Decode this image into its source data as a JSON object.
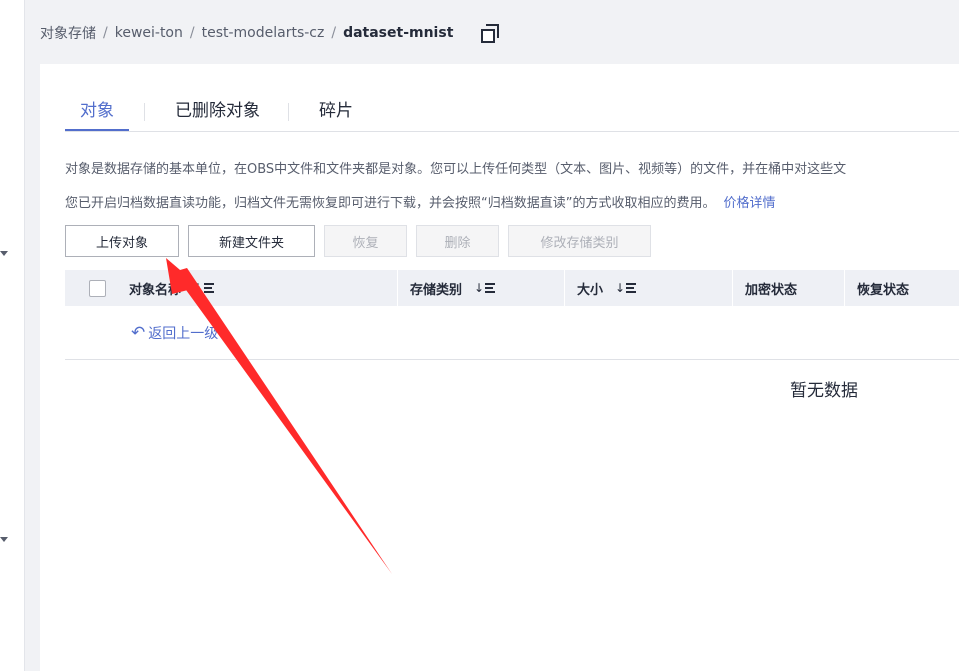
{
  "breadcrumb": {
    "items": [
      "对象存储",
      "kewei-ton",
      "test-modelarts-cz"
    ],
    "current": "dataset-mnist",
    "separator": "/",
    "copy_icon": "copy-icon"
  },
  "tabs": [
    {
      "label": "对象",
      "active": true
    },
    {
      "label": "已删除对象",
      "active": false
    },
    {
      "label": "碎片",
      "active": false
    }
  ],
  "description": {
    "line1": "对象是数据存储的基本单位，在OBS中文件和文件夹都是对象。您可以上传任何类型（文本、图片、视频等）的文件，并在桶中对这些文",
    "line2": "您已开启归档数据直读功能，归档文件无需恢复即可进行下载，并会按照“归档数据直读”的方式收取相应的费用。",
    "link": "价格详情"
  },
  "toolbar": {
    "upload": "上传对象",
    "new_folder": "新建文件夹",
    "restore": "恢复",
    "delete": "删除",
    "modify_storage": "修改存储类别"
  },
  "table": {
    "columns": [
      "对象名称",
      "存储类别",
      "大小",
      "加密状态",
      "恢复状态"
    ],
    "back_link": "返回上一级",
    "empty_text": "暂无数据"
  },
  "colors": {
    "accent": "#526ecc",
    "annotation_arrow": "#ff2a2a"
  }
}
